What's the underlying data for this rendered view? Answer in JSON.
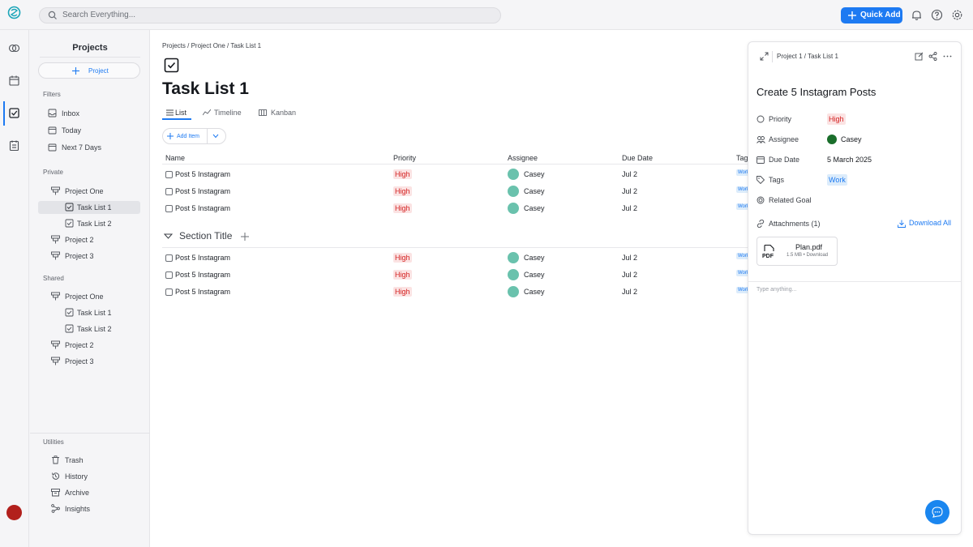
{
  "topbar": {
    "search_placeholder": "Search Everything...",
    "quick_add_label": "Quick Add",
    "accent_color": "#1d7af2"
  },
  "rail": {
    "icons": [
      "brain-icon",
      "calendar-icon",
      "task-check-icon",
      "notes-icon"
    ]
  },
  "sidebar": {
    "title": "Projects",
    "new_project_label": "Project",
    "filters_label": "Filters",
    "filters": [
      {
        "label": "Inbox",
        "icon": "inbox-icon"
      },
      {
        "label": "Today",
        "icon": "calendar-icon"
      },
      {
        "label": "Next 7 Days",
        "icon": "calendar-icon"
      }
    ],
    "private_label": "Private",
    "private_items": [
      {
        "label": "Project One"
      },
      {
        "label": "Task List 1"
      },
      {
        "label": "Task List 2"
      },
      {
        "label": "Project 2"
      },
      {
        "label": "Project 3"
      }
    ],
    "shared_label": "Shared",
    "shared_items": [
      {
        "label": "Project One"
      },
      {
        "label": "Task List 1"
      },
      {
        "label": "Task List 2"
      },
      {
        "label": "Project 2"
      },
      {
        "label": "Project 3"
      }
    ],
    "utilities_label": "Utilities",
    "utilities": [
      {
        "label": "Trash"
      },
      {
        "label": "History"
      },
      {
        "label": "Archive"
      },
      {
        "label": "Insights"
      }
    ]
  },
  "main": {
    "breadcrumb": "Projects / Project One / Task List 1",
    "title": "Task List 1",
    "tabs": [
      {
        "label": "List"
      },
      {
        "label": "Timeline"
      },
      {
        "label": "Kanban"
      }
    ],
    "add_item_label": "Add Item",
    "columns": [
      "Name",
      "Priority",
      "Assignee",
      "Due Date",
      "Tags"
    ],
    "rows": [
      {
        "name": "Post 5 Instagram",
        "priority": "High",
        "assignee": "Casey",
        "due": "Jul 2",
        "tag": "Work"
      },
      {
        "name": "Post 5 Instagram",
        "priority": "High",
        "assignee": "Casey",
        "due": "Jul 2",
        "tag": "Work"
      },
      {
        "name": "Post 5 Instagram",
        "priority": "High",
        "assignee": "Casey",
        "due": "Jul 2",
        "tag": "Work"
      }
    ],
    "section_title": "Section Title",
    "section_rows": [
      {
        "name": "Post 5 Instagram",
        "priority": "High",
        "assignee": "Casey",
        "due": "Jul 2",
        "tag": "Work"
      },
      {
        "name": "Post 5 Instagram",
        "priority": "High",
        "assignee": "Casey",
        "due": "Jul 2",
        "tag": "Work"
      },
      {
        "name": "Post 5 Instagram",
        "priority": "High",
        "assignee": "Casey",
        "due": "Jul 2",
        "tag": "Work"
      }
    ]
  },
  "panel": {
    "breadcrumb": "Project 1 / Task List 1",
    "title": "Create 5 Instagram Posts",
    "priority_label": "Priority",
    "priority_value": "High",
    "assignee_label": "Assignee",
    "assignee_value": "Casey",
    "due_label": "Due Date",
    "due_value": "5 March 2025",
    "tags_label": "Tags",
    "tags_value": "Work",
    "goal_label": "Related Goal",
    "attachments_label": "Attachments (1)",
    "download_all_label": "Download All",
    "file_name": "Plan.pdf",
    "file_meta": "1.5 MB • Download",
    "file_type": "PDF",
    "comment_placeholder": "Type anything..."
  }
}
